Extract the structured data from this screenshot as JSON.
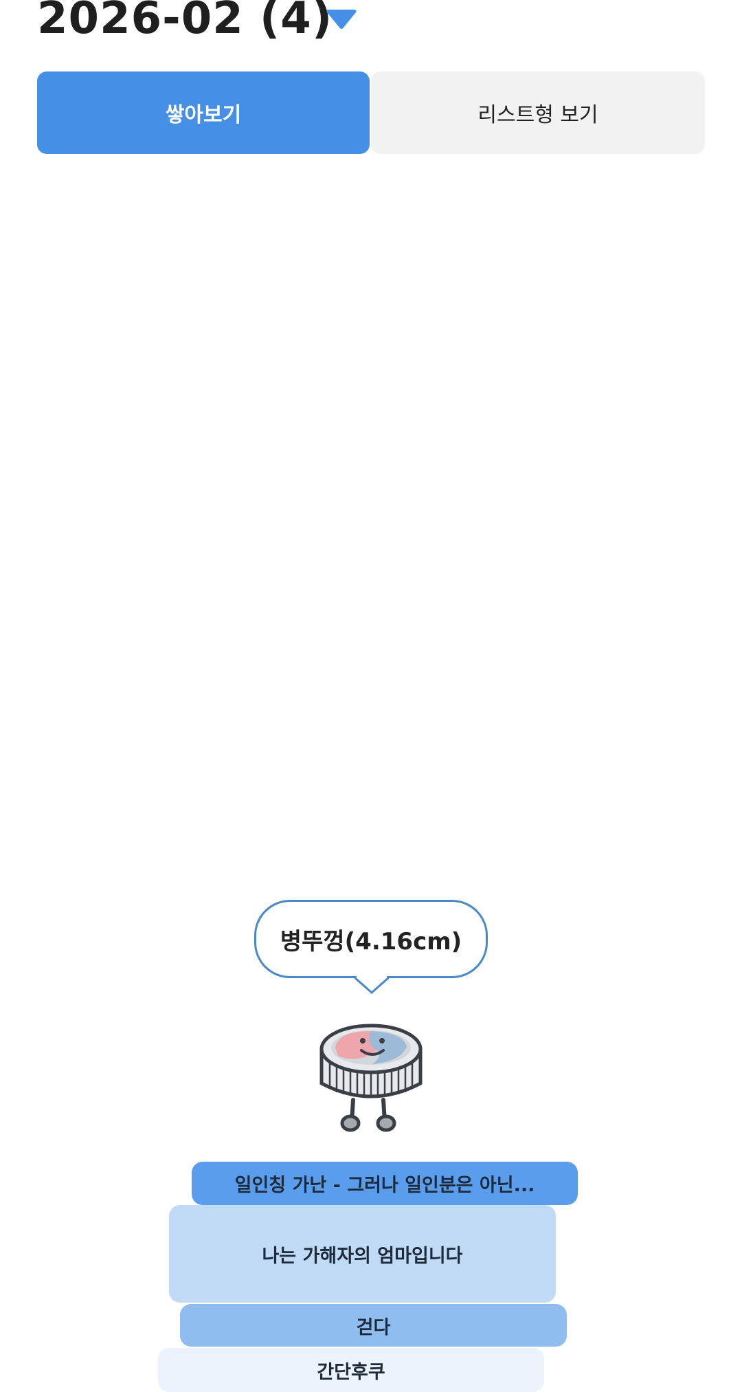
{
  "header": {
    "title": "2026-02 (4)",
    "dropdown_icon": "triangle-down-icon",
    "accent_color": "#4590e6"
  },
  "view_toggle": {
    "stack_label": "쌓아보기",
    "list_label": "리스트형 보기",
    "selected": "stack"
  },
  "stack": {
    "height_label": "병뚜껑(4.16cm)",
    "mascot_icon": "bottle-cap-mascot-icon",
    "books": [
      {
        "title": "일인칭 가난 - 그러나 일인분은 아닌...",
        "color": "#5b9ded"
      },
      {
        "title": "나는 가해자의 엄마입니다",
        "color": "#c1daf6"
      },
      {
        "title": "걷다",
        "color": "#8fbdf0"
      },
      {
        "title": "간단후쿠",
        "color": "#ecf3fc"
      }
    ]
  }
}
